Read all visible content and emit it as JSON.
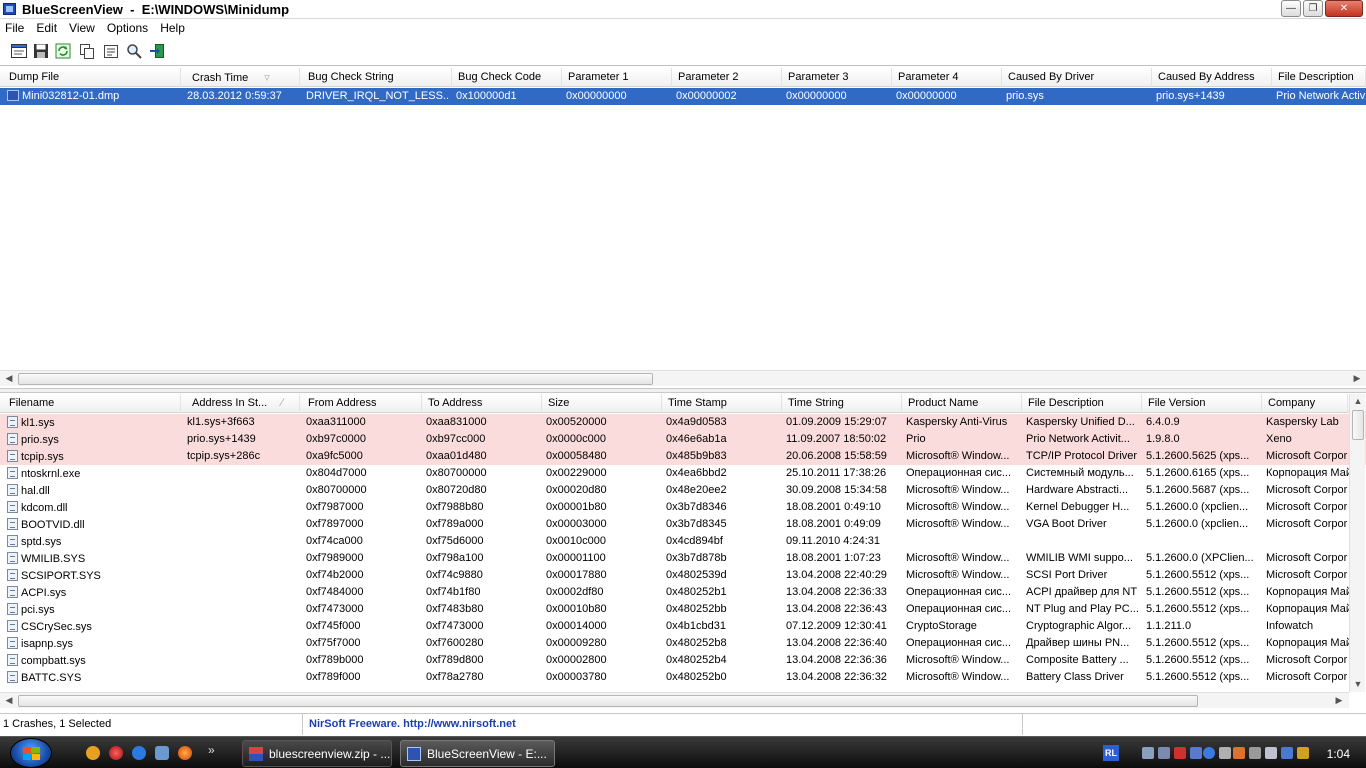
{
  "window": {
    "title": "BlueScreenView  -  E:\\WINDOWS\\Minidump"
  },
  "menu": [
    "File",
    "Edit",
    "View",
    "Options",
    "Help"
  ],
  "toolbar": {
    "buttons": [
      "html-report-icon",
      "save-icon",
      "refresh-icon",
      "copy-icon",
      "properties-icon",
      "find-icon",
      "exit-icon"
    ]
  },
  "dumps": {
    "columns": [
      "Dump File",
      "Crash Time",
      "Bug Check String",
      "Bug Check Code",
      "Parameter 1",
      "Parameter 2",
      "Parameter 3",
      "Parameter 4",
      "Caused By Driver",
      "Caused By Address",
      "File Description"
    ],
    "rows": [
      [
        "Mini032812-01.dmp",
        "28.03.2012 0:59:37",
        "DRIVER_IRQL_NOT_LESS...",
        "0x100000d1",
        "0x00000000",
        "0x00000002",
        "0x00000000",
        "0x00000000",
        "prio.sys",
        "prio.sys+1439",
        "Prio Network Activ"
      ]
    ]
  },
  "drivers": {
    "columns": [
      "Filename",
      "Address In St...",
      "From Address",
      "To Address",
      "Size",
      "Time Stamp",
      "Time String",
      "Product Name",
      "File Description",
      "File Version",
      "Company"
    ],
    "rows": [
      [
        "kl1.sys",
        "kl1.sys+3f663",
        "0xaa311000",
        "0xaa831000",
        "0x00520000",
        "0x4a9d0583",
        "01.09.2009 15:29:07",
        "Kaspersky Anti-Virus",
        "Kaspersky Unified D...",
        "6.4.0.9",
        "Kaspersky Lab"
      ],
      [
        "prio.sys",
        "prio.sys+1439",
        "0xb97c0000",
        "0xb97cc000",
        "0x0000c000",
        "0x46e6ab1a",
        "11.09.2007 18:50:02",
        "Prio",
        "Prio Network Activit...",
        "1.9.8.0",
        "Xeno"
      ],
      [
        "tcpip.sys",
        "tcpip.sys+286c",
        "0xa9fc5000",
        "0xaa01d480",
        "0x00058480",
        "0x485b9b83",
        "20.06.2008 15:58:59",
        "Microsoft® Window...",
        "TCP/IP Protocol Driver",
        "5.1.2600.5625 (xps...",
        "Microsoft Corpor"
      ],
      [
        "ntoskrnl.exe",
        "",
        "0x804d7000",
        "0x80700000",
        "0x00229000",
        "0x4ea6bbd2",
        "25.10.2011 17:38:26",
        "Операционная сис...",
        "Системный модуль...",
        "5.1.2600.6165 (xps...",
        "Корпорация Май"
      ],
      [
        "hal.dll",
        "",
        "0x80700000",
        "0x80720d80",
        "0x00020d80",
        "0x48e20ee2",
        "30.09.2008 15:34:58",
        "Microsoft® Window...",
        "Hardware Abstracti...",
        "5.1.2600.5687 (xps...",
        "Microsoft Corpor"
      ],
      [
        "kdcom.dll",
        "",
        "0xf7987000",
        "0xf7988b80",
        "0x00001b80",
        "0x3b7d8346",
        "18.08.2001 0:49:10",
        "Microsoft® Window...",
        "Kernel Debugger H...",
        "5.1.2600.0 (xpclien...",
        "Microsoft Corpor"
      ],
      [
        "BOOTVID.dll",
        "",
        "0xf7897000",
        "0xf789a000",
        "0x00003000",
        "0x3b7d8345",
        "18.08.2001 0:49:09",
        "Microsoft® Window...",
        "VGA Boot Driver",
        "5.1.2600.0 (xpclien...",
        "Microsoft Corpor"
      ],
      [
        "sptd.sys",
        "",
        "0xf74ca000",
        "0xf75d6000",
        "0x0010c000",
        "0x4cd894bf",
        "09.11.2010 4:24:31",
        "",
        "",
        "",
        ""
      ],
      [
        "WMILIB.SYS",
        "",
        "0xf7989000",
        "0xf798a100",
        "0x00001100",
        "0x3b7d878b",
        "18.08.2001 1:07:23",
        "Microsoft® Window...",
        "WMILIB WMI suppo...",
        "5.1.2600.0 (XPClien...",
        "Microsoft Corpor"
      ],
      [
        "SCSIPORT.SYS",
        "",
        "0xf74b2000",
        "0xf74c9880",
        "0x00017880",
        "0x4802539d",
        "13.04.2008 22:40:29",
        "Microsoft® Window...",
        "SCSI Port Driver",
        "5.1.2600.5512 (xps...",
        "Microsoft Corpor"
      ],
      [
        "ACPI.sys",
        "",
        "0xf7484000",
        "0xf74b1f80",
        "0x0002df80",
        "0x480252b1",
        "13.04.2008 22:36:33",
        "Операционная сис...",
        "ACPI драйвер для NT",
        "5.1.2600.5512 (xps...",
        "Корпорация Май"
      ],
      [
        "pci.sys",
        "",
        "0xf7473000",
        "0xf7483b80",
        "0x00010b80",
        "0x480252bb",
        "13.04.2008 22:36:43",
        "Операционная сис...",
        "NT Plug and Play PC...",
        "5.1.2600.5512 (xps...",
        "Корпорация Май"
      ],
      [
        "CSCrySec.sys",
        "",
        "0xf745f000",
        "0xf7473000",
        "0x00014000",
        "0x4b1cbd31",
        "07.12.2009 12:30:41",
        "CryptoStorage",
        "Cryptographic Algor...",
        "1.1.211.0",
        "Infowatch"
      ],
      [
        "isapnp.sys",
        "",
        "0xf75f7000",
        "0xf7600280",
        "0x00009280",
        "0x480252b8",
        "13.04.2008 22:36:40",
        "Операционная сис...",
        "Драйвер шины PN...",
        "5.1.2600.5512 (xps...",
        "Корпорация Май"
      ],
      [
        "compbatt.sys",
        "",
        "0xf789b000",
        "0xf789d800",
        "0x00002800",
        "0x480252b4",
        "13.04.2008 22:36:36",
        "Microsoft® Window...",
        "Composite Battery ...",
        "5.1.2600.5512 (xps...",
        "Microsoft Corpor"
      ],
      [
        "BATTC.SYS",
        "",
        "0xf789f000",
        "0xf78a2780",
        "0x00003780",
        "0x480252b0",
        "13.04.2008 22:36:32",
        "Microsoft® Window...",
        "Battery Class Driver",
        "5.1.2600.5512 (xps...",
        "Microsoft Corpor"
      ]
    ]
  },
  "status": {
    "count": "1 Crashes, 1 Selected",
    "freeware": "NirSoft Freeware.  http://www.nirsoft.net"
  },
  "taskbar": {
    "tasks": [
      "bluescreenview.zip - ...",
      "BlueScreenView  -  E:..."
    ],
    "lang": "RL",
    "clock": "1:04",
    "quicklaunch_more": "»"
  },
  "colors": {
    "selection": "#316ac5",
    "highlight_row": "#fbdcdc",
    "link": "#1a3fb0"
  }
}
